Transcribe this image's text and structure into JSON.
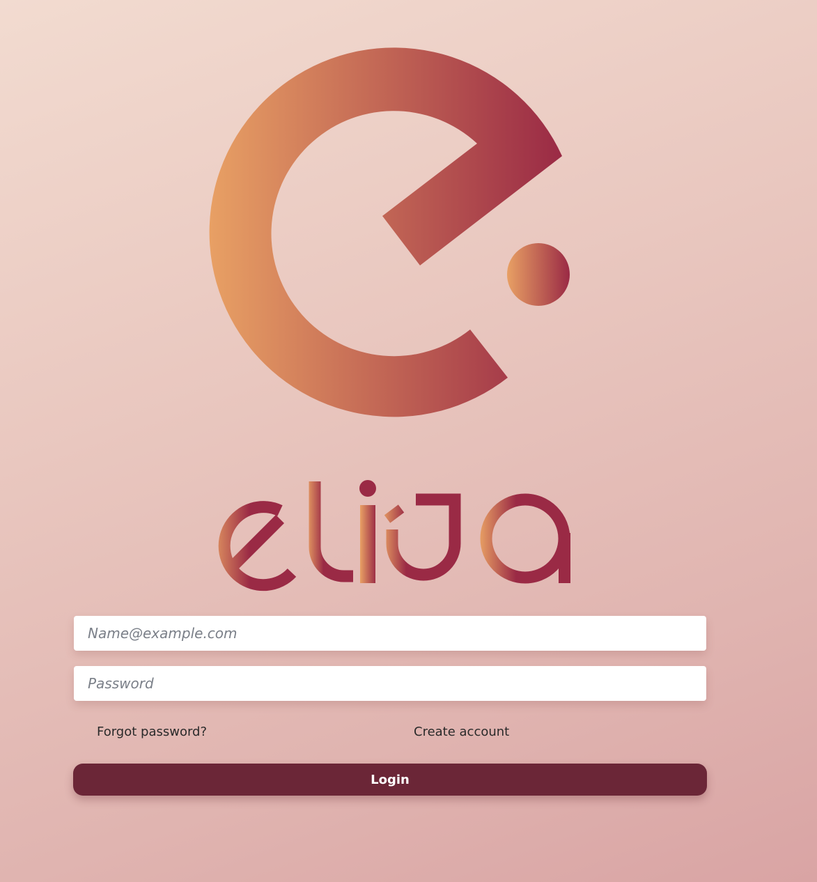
{
  "brand": {
    "wordmark_text": "eliza",
    "gradient_start": "#e8a064",
    "gradient_end": "#9a2a45"
  },
  "form": {
    "email_placeholder": "Name@example.com",
    "email_value": "",
    "password_placeholder": "Password",
    "password_value": "",
    "forgot_password_label": "Forgot password?",
    "create_account_label": "Create account",
    "login_label": "Login",
    "login_button_color": "#6b2637"
  }
}
